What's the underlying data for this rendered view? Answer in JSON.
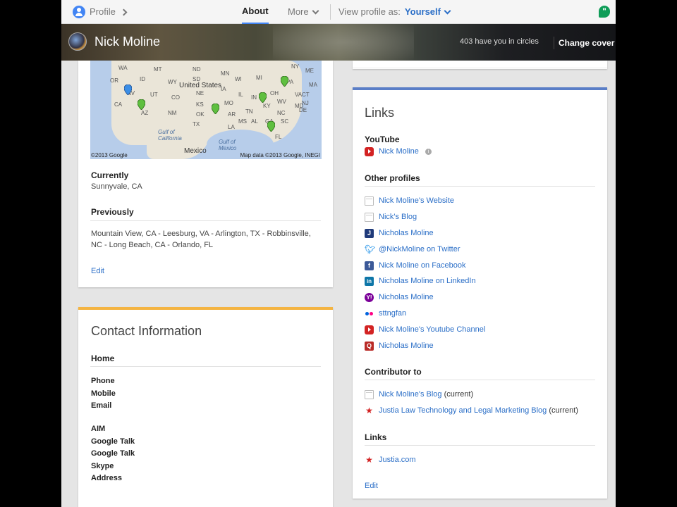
{
  "nav": {
    "profile_label": "Profile",
    "about_tab": "About",
    "more_tab": "More",
    "view_as_label": "View profile as:",
    "view_as_value": "Yourself"
  },
  "cover": {
    "name": "Nick Moline",
    "circles_text": "403 have you in circles",
    "change_cover_label": "Change cover"
  },
  "places": {
    "map": {
      "country_label": "United States",
      "mexico_label": "Mexico",
      "gulf_california": "Gulf of California",
      "gulf_mexico": "Gulf of Mexico",
      "copyright_left": "©2013 Google",
      "copyright_right": "Map data ©2013 Google, INEGI",
      "states": [
        "WA",
        "MT",
        "ND",
        "MN",
        "OR",
        "ID",
        "WY",
        "SD",
        "WI",
        "MI",
        "NY",
        "NV",
        "UT",
        "CO",
        "NE",
        "IA",
        "IL",
        "IN",
        "OH",
        "PA",
        "CA",
        "KS",
        "MO",
        "KY",
        "WV",
        "VA",
        "AZ",
        "NM",
        "OK",
        "AR",
        "TN",
        "NC",
        "SC",
        "TX",
        "LA",
        "MS",
        "AL",
        "GA",
        "FL",
        "ME",
        "MA",
        "CT",
        "NJ",
        "DE",
        "MD"
      ]
    },
    "currently_label": "Currently",
    "currently_value": "Sunnyvale, CA",
    "previously_label": "Previously",
    "previously_value": "Mountain View, CA - Leesburg, VA - Arlington, TX - Robbinsville, NC - Long Beach, CA - Orlando, FL",
    "edit_label": "Edit"
  },
  "contact": {
    "title": "Contact Information",
    "home_label": "Home",
    "fields_a": [
      "Phone",
      "Mobile",
      "Email"
    ],
    "fields_b": [
      "AIM",
      "Google Talk",
      "Google Talk",
      "Skype",
      "Address"
    ]
  },
  "links": {
    "title": "Links",
    "youtube_label": "YouTube",
    "youtube_link": "Nick Moline",
    "other_profiles_label": "Other profiles",
    "other_profiles": [
      {
        "icon": "page-icon",
        "label": "Nick Moline's Website"
      },
      {
        "icon": "page-icon",
        "label": "Nick's Blog"
      },
      {
        "icon": "j-icon",
        "label": "Nicholas Moline"
      },
      {
        "icon": "twitter-icon",
        "label": "@NickMoline on Twitter"
      },
      {
        "icon": "facebook-icon",
        "label": "Nick Moline on Facebook"
      },
      {
        "icon": "linkedin-icon",
        "label": "Nicholas Moline on LinkedIn"
      },
      {
        "icon": "yahoo-icon",
        "label": "Nicholas Moline"
      },
      {
        "icon": "flickr-icon",
        "label": "sttngfan"
      },
      {
        "icon": "youtube-icon",
        "label": "Nick Moline's Youtube Channel"
      },
      {
        "icon": "quora-icon",
        "label": "Nicholas Moline"
      }
    ],
    "contributor_label": "Contributor to",
    "contributor": [
      {
        "icon": "page-icon",
        "label": "Nick Moline's Blog",
        "suffix": "(current)"
      },
      {
        "icon": "justia-icon",
        "label": "Justia Law Technology and Legal Marketing Blog",
        "suffix": "(current)"
      }
    ],
    "links_label": "Links",
    "links_items": [
      {
        "icon": "justia-icon",
        "label": "Justia.com"
      }
    ],
    "edit_label": "Edit"
  },
  "colors": {
    "accent_blue": "#4285f4",
    "link": "#2a6ec7",
    "contact_bar": "#f4b442",
    "links_bar": "#5a7ec7"
  }
}
